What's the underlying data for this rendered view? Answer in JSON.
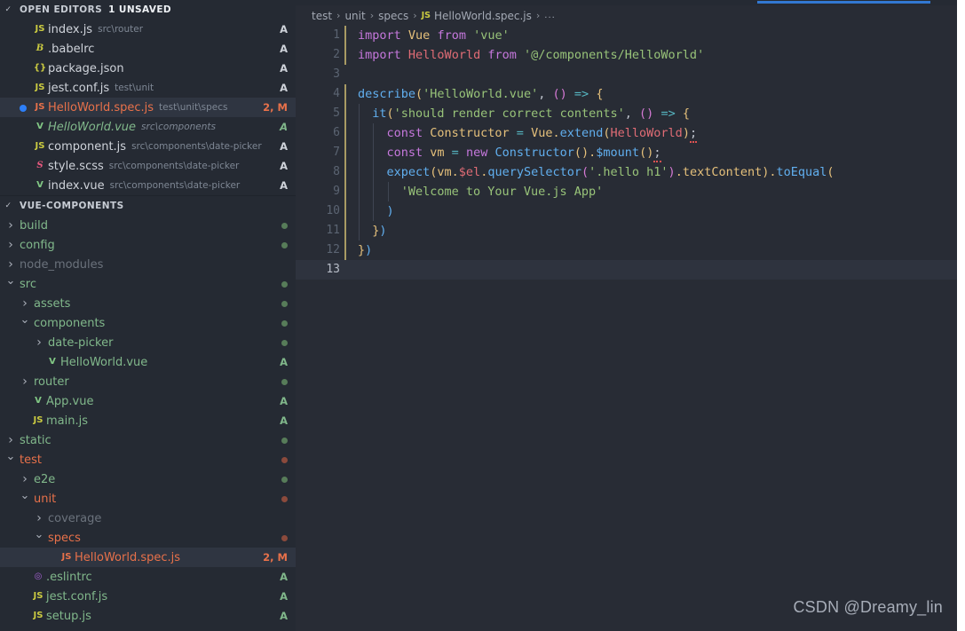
{
  "sidebar": {
    "open_editors": {
      "title": "OPEN EDITORS",
      "unsaved_badge": "1 UNSAVED",
      "chevron": "chevron-down-icon",
      "items": [
        {
          "icon": "js",
          "icon_text": "JS",
          "name": "index.js",
          "desc": "src\\router",
          "status": "A",
          "selected": false,
          "unsaved": false,
          "color": "plain"
        },
        {
          "icon": "babel",
          "icon_text": "B",
          "name": ".babelrc",
          "desc": "",
          "status": "A",
          "selected": false,
          "unsaved": false,
          "color": "plain"
        },
        {
          "icon": "json",
          "icon_text": "{}",
          "name": "package.json",
          "desc": "",
          "status": "A",
          "selected": false,
          "unsaved": false,
          "color": "plain"
        },
        {
          "icon": "js",
          "icon_text": "JS",
          "name": "jest.conf.js",
          "desc": "test\\unit",
          "status": "A",
          "selected": false,
          "unsaved": false,
          "color": "plain"
        },
        {
          "icon": "js-mod",
          "icon_text": "JS",
          "name": "HelloWorld.spec.js",
          "desc": "test\\unit\\specs",
          "status": "2, M",
          "selected": true,
          "unsaved": true,
          "color": "red"
        },
        {
          "icon": "vue",
          "icon_text": "V",
          "name": "HelloWorld.vue",
          "desc": "src\\components",
          "status": "A",
          "selected": false,
          "unsaved": false,
          "color": "green",
          "italic": true
        },
        {
          "icon": "js",
          "icon_text": "JS",
          "name": "component.js",
          "desc": "src\\components\\date-picker",
          "status": "A",
          "selected": false,
          "unsaved": false,
          "color": "plain"
        },
        {
          "icon": "sass",
          "icon_text": "S",
          "name": "style.scss",
          "desc": "src\\components\\date-picker",
          "status": "A",
          "selected": false,
          "unsaved": false,
          "color": "plain"
        },
        {
          "icon": "vue",
          "icon_text": "V",
          "name": "index.vue",
          "desc": "src\\components\\date-picker",
          "status": "A",
          "selected": false,
          "unsaved": false,
          "color": "plain"
        }
      ]
    },
    "explorer": {
      "title": "VUE-COMPONENTS",
      "chevron": "chevron-down-icon",
      "items": [
        {
          "twist": "right",
          "indent": 0,
          "icon": "",
          "icon_text": "",
          "name": "build",
          "status": "",
          "dot": "green",
          "color": "green"
        },
        {
          "twist": "right",
          "indent": 0,
          "icon": "",
          "icon_text": "",
          "name": "config",
          "status": "",
          "dot": "green",
          "color": "green"
        },
        {
          "twist": "right",
          "indent": 0,
          "icon": "",
          "icon_text": "",
          "name": "node_modules",
          "status": "",
          "dot": "",
          "color": "grey"
        },
        {
          "twist": "down",
          "indent": 0,
          "icon": "",
          "icon_text": "",
          "name": "src",
          "status": "",
          "dot": "green",
          "color": "green"
        },
        {
          "twist": "right",
          "indent": 1,
          "icon": "",
          "icon_text": "",
          "name": "assets",
          "status": "",
          "dot": "green",
          "color": "green"
        },
        {
          "twist": "down",
          "indent": 1,
          "icon": "",
          "icon_text": "",
          "name": "components",
          "status": "",
          "dot": "green",
          "color": "green"
        },
        {
          "twist": "right",
          "indent": 2,
          "icon": "",
          "icon_text": "",
          "name": "date-picker",
          "status": "",
          "dot": "green",
          "color": "green"
        },
        {
          "twist": "",
          "indent": 2,
          "icon": "vue",
          "icon_text": "V",
          "name": "HelloWorld.vue",
          "status": "A",
          "dot": "",
          "color": "green"
        },
        {
          "twist": "right",
          "indent": 1,
          "icon": "",
          "icon_text": "",
          "name": "router",
          "status": "",
          "dot": "green",
          "color": "green"
        },
        {
          "twist": "",
          "indent": 1,
          "icon": "vue",
          "icon_text": "V",
          "name": "App.vue",
          "status": "A",
          "dot": "",
          "color": "green"
        },
        {
          "twist": "",
          "indent": 1,
          "icon": "js",
          "icon_text": "JS",
          "name": "main.js",
          "status": "A",
          "dot": "",
          "color": "green"
        },
        {
          "twist": "right",
          "indent": 0,
          "icon": "",
          "icon_text": "",
          "name": "static",
          "status": "",
          "dot": "green",
          "color": "green"
        },
        {
          "twist": "down",
          "indent": 0,
          "icon": "",
          "icon_text": "",
          "name": "test",
          "status": "",
          "dot": "red",
          "color": "red"
        },
        {
          "twist": "right",
          "indent": 1,
          "icon": "",
          "icon_text": "",
          "name": "e2e",
          "status": "",
          "dot": "green",
          "color": "green"
        },
        {
          "twist": "down",
          "indent": 1,
          "icon": "",
          "icon_text": "",
          "name": "unit",
          "status": "",
          "dot": "red",
          "color": "red"
        },
        {
          "twist": "right",
          "indent": 2,
          "icon": "",
          "icon_text": "",
          "name": "coverage",
          "status": "",
          "dot": "",
          "color": "grey"
        },
        {
          "twist": "down",
          "indent": 2,
          "icon": "",
          "icon_text": "",
          "name": "specs",
          "status": "",
          "dot": "red",
          "color": "red"
        },
        {
          "twist": "",
          "indent": 3,
          "icon": "js-mod",
          "icon_text": "JS",
          "name": "HelloWorld.spec.js",
          "status": "2, M",
          "dot": "",
          "color": "red",
          "selected": true
        },
        {
          "twist": "",
          "indent": 1,
          "icon": "eslint",
          "icon_text": "◎",
          "name": ".eslintrc",
          "status": "A",
          "dot": "",
          "color": "green"
        },
        {
          "twist": "",
          "indent": 1,
          "icon": "js",
          "icon_text": "JS",
          "name": "jest.conf.js",
          "status": "A",
          "dot": "",
          "color": "green"
        },
        {
          "twist": "",
          "indent": 1,
          "icon": "js",
          "icon_text": "JS",
          "name": "setup.js",
          "status": "A",
          "dot": "",
          "color": "green"
        }
      ]
    }
  },
  "editor": {
    "breadcrumb": [
      "test",
      "unit",
      "specs",
      "HelloWorld.spec.js",
      "..."
    ],
    "breadcrumb_file_icon": "js-file-icon",
    "active_tab_accent": "#3278d2",
    "filename": "HelloWorld.spec.js",
    "language": "javascript",
    "current_line": 13,
    "lines": [
      {
        "n": 1,
        "text": "import Vue from 'vue'"
      },
      {
        "n": 2,
        "text": "import HelloWorld from '@/components/HelloWorld'"
      },
      {
        "n": 3,
        "text": ""
      },
      {
        "n": 4,
        "text": "describe('HelloWorld.vue', () => {"
      },
      {
        "n": 5,
        "text": "  it('should render correct contents', () => {"
      },
      {
        "n": 6,
        "text": "    const Constructor = Vue.extend(HelloWorld);"
      },
      {
        "n": 7,
        "text": "    const vm = new Constructor().$mount();"
      },
      {
        "n": 8,
        "text": "    expect(vm.$el.querySelector('.hello h1').textContent).toEqual("
      },
      {
        "n": 9,
        "text": "      'Welcome to Your Vue.js App'"
      },
      {
        "n": 10,
        "text": "    )"
      },
      {
        "n": 11,
        "text": "  })"
      },
      {
        "n": 12,
        "text": "})"
      },
      {
        "n": 13,
        "text": ""
      }
    ]
  },
  "watermark": "CSDN @Dreamy_lin",
  "colors": {
    "sidebar_bg": "#252a33",
    "editor_bg": "#282c35",
    "accent_blue": "#3278d2",
    "modified_red": "#e8714a",
    "added_green": "#81b88b",
    "ignored_grey": "#6b727c"
  }
}
